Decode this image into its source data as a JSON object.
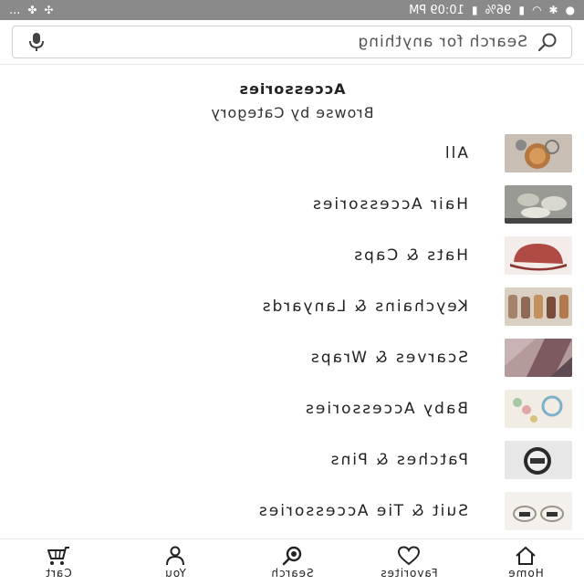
{
  "status_bar": {
    "time": "10:09 PM",
    "battery": "96%",
    "overflow": "..."
  },
  "search": {
    "placeholder": "Search for anything"
  },
  "header": {
    "title": "Accessories",
    "subtitle": "Browse by Category"
  },
  "categories": [
    {
      "label": "All",
      "thumb_icon": "keychain-thumbnail",
      "thumb_color": "#b7a89c"
    },
    {
      "label": "Hair Accessories",
      "thumb_icon": "hair-clip-thumbnail",
      "thumb_color": "#8c8c86"
    },
    {
      "label": "Hats & Caps",
      "thumb_icon": "cap-thumbnail",
      "thumb_color": "#b04a45"
    },
    {
      "label": "Keychains & Lanyards",
      "thumb_icon": "keychains-thumbnail",
      "thumb_color": "#a07a60"
    },
    {
      "label": "Scarves & Wraps",
      "thumb_icon": "scarf-thumbnail",
      "thumb_color": "#8d6f72"
    },
    {
      "label": "Baby Accessories",
      "thumb_icon": "baby-accessory-thumbnail",
      "thumb_color": "#d9cdbd"
    },
    {
      "label": "Patches & Pins",
      "thumb_icon": "pin-thumbnail",
      "thumb_color": "#9b9b9b"
    },
    {
      "label": "Suit & Tie Accessories",
      "thumb_icon": "cufflinks-thumbnail",
      "thumb_color": "#cfc9c2"
    }
  ],
  "bottom_nav": [
    {
      "label": "Home",
      "icon": "home-icon"
    },
    {
      "label": "Favorites",
      "icon": "heart-icon"
    },
    {
      "label": "Search",
      "icon": "search-icon"
    },
    {
      "label": "You",
      "icon": "person-icon"
    },
    {
      "label": "Cart",
      "icon": "cart-icon"
    }
  ],
  "colors": {
    "status_bar_bg": "#8a8a8a",
    "text": "#222222",
    "divider": "#e6e6e6"
  }
}
